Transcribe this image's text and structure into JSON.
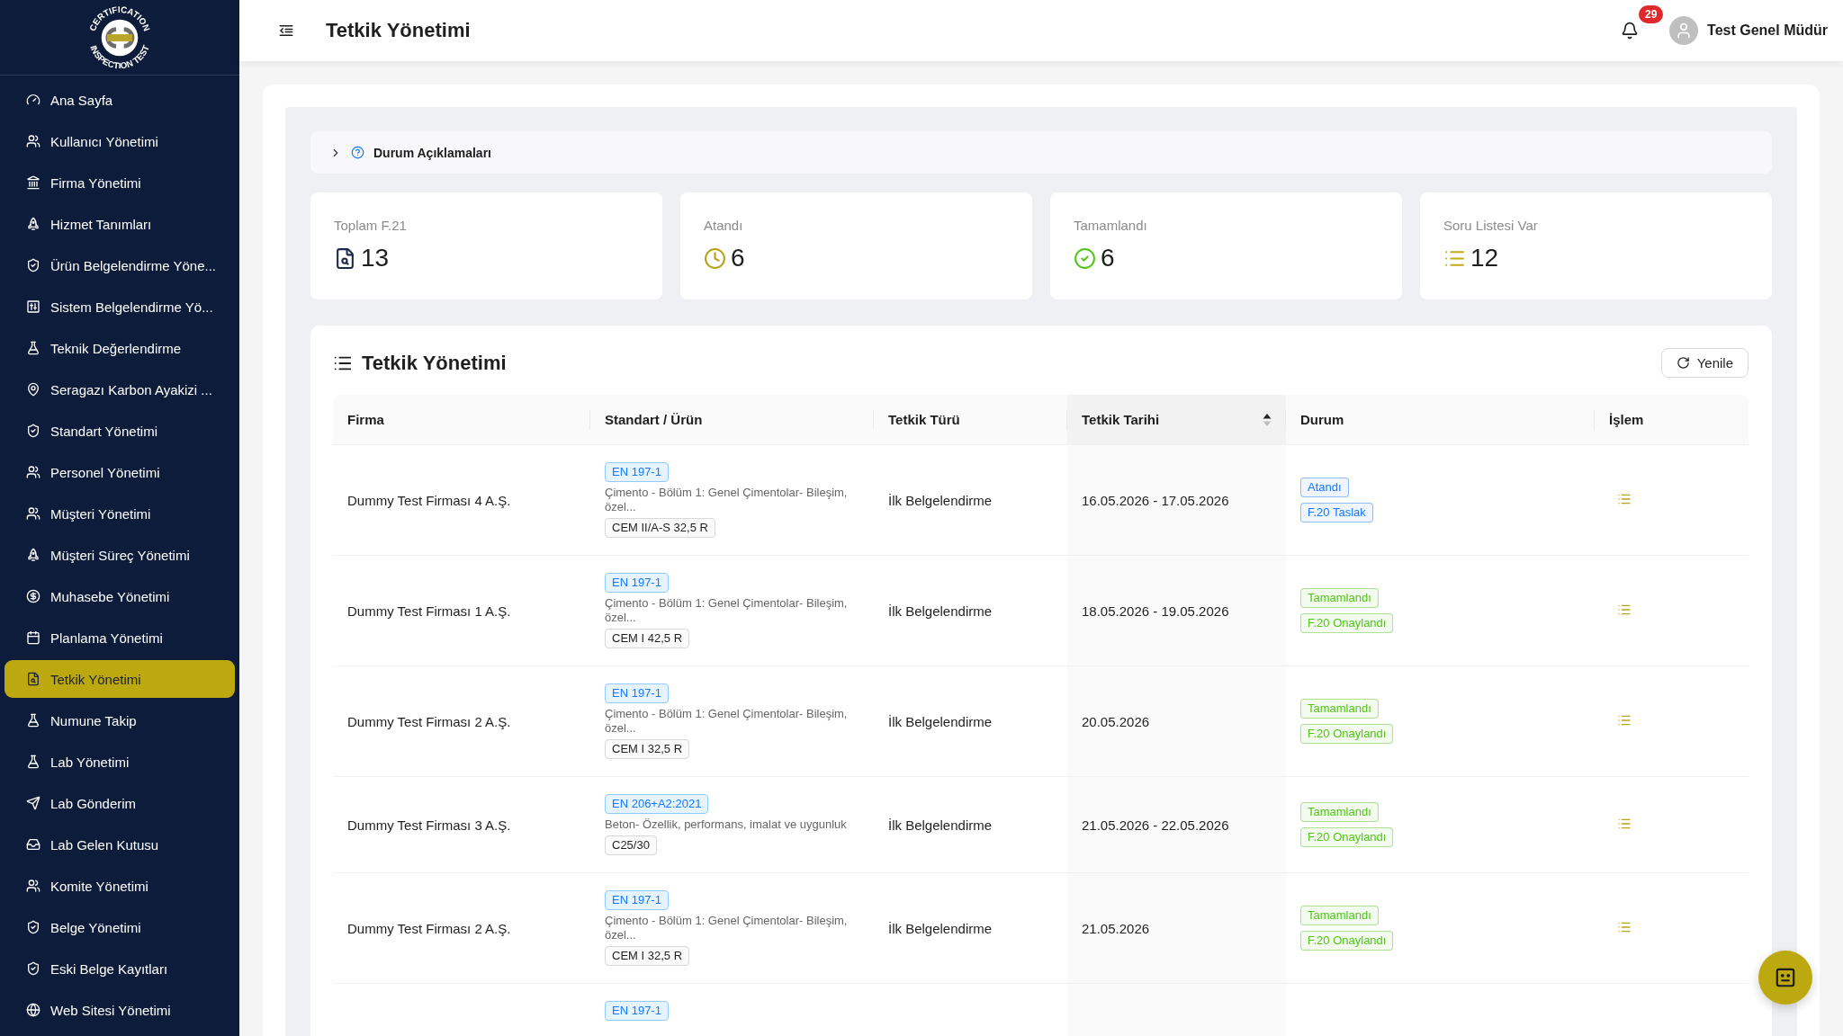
{
  "sidebar": {
    "logo": {
      "text_top": "CERTIFICATION",
      "text_bottom": "INSPECTION TEST"
    },
    "items": [
      {
        "label": "Ana Sayfa",
        "selected": false
      },
      {
        "label": "Kullanıcı Yönetimi",
        "selected": false
      },
      {
        "label": "Firma Yönetimi",
        "selected": false
      },
      {
        "label": "Hizmet Tanımları",
        "selected": false
      },
      {
        "label": "Ürün Belgelendirme Yöne...",
        "selected": false
      },
      {
        "label": "Sistem Belgelendirme Yö...",
        "selected": false
      },
      {
        "label": "Teknik Değerlendirme",
        "selected": false
      },
      {
        "label": "Seragazı Karbon Ayakizi ...",
        "selected": false
      },
      {
        "label": "Standart Yönetimi",
        "selected": false
      },
      {
        "label": "Personel Yönetimi",
        "selected": false
      },
      {
        "label": "Müşteri Yönetimi",
        "selected": false
      },
      {
        "label": "Müşteri Süreç Yönetimi",
        "selected": false
      },
      {
        "label": "Muhasebe Yönetimi",
        "selected": false
      },
      {
        "label": "Planlama Yönetimi",
        "selected": false
      },
      {
        "label": "Tetkik Yönetimi",
        "selected": true
      },
      {
        "label": "Numune Takip",
        "selected": false
      },
      {
        "label": "Lab Yönetimi",
        "selected": false
      },
      {
        "label": "Lab Gönderim",
        "selected": false
      },
      {
        "label": "Lab Gelen Kutusu",
        "selected": false
      },
      {
        "label": "Komite Yönetimi",
        "selected": false
      },
      {
        "label": "Belge Yönetimi",
        "selected": false
      },
      {
        "label": "Eski Belge Kayıtları",
        "selected": false
      },
      {
        "label": "Web Sitesi Yönetimi",
        "selected": false
      }
    ]
  },
  "header": {
    "title": "Tetkik Yönetimi",
    "notifications": "29",
    "user": "Test Genel Müdür"
  },
  "legend": {
    "title": "Durum Açıklamaları",
    "expanded": false
  },
  "stats": [
    {
      "label": "Toplam F.21",
      "value": "13"
    },
    {
      "label": "Atandı",
      "value": "6"
    },
    {
      "label": "Tamamlandı",
      "value": "6"
    },
    {
      "label": "Soru Listesi Var",
      "value": "12"
    }
  ],
  "table": {
    "title": "Tetkik Yönetimi",
    "refresh": "Yenile",
    "columns": [
      {
        "label": "Firma",
        "sorted": false
      },
      {
        "label": "Standart / Ürün",
        "sorted": false
      },
      {
        "label": "Tetkik Türü",
        "sorted": false
      },
      {
        "label": "Tetkik Tarihi",
        "sorted": true
      },
      {
        "label": "Durum",
        "sorted": false
      },
      {
        "label": "İşlem",
        "sorted": false
      }
    ],
    "rows": [
      {
        "firm": "Dummy Test Firması 4 A.Ş.",
        "standard": "EN 197-1",
        "description": "Çimento - Bölüm 1: Genel Çimentolar- Bileşim, özel...",
        "product": "CEM II/A-S 32,5 R",
        "type": "İlk Belgelendirme",
        "date": "16.05.2026 - 17.05.2026",
        "statuses": [
          {
            "label": "Atandı",
            "color": "#1677ff"
          },
          {
            "label": "F.20 Taslak",
            "color": "#1677ff"
          }
        ]
      },
      {
        "firm": "Dummy Test Firması 1 A.Ş.",
        "standard": "EN 197-1",
        "description": "Çimento - Bölüm 1: Genel Çimentolar- Bileşim, özel...",
        "product": "CEM I 42,5 R",
        "type": "İlk Belgelendirme",
        "date": "18.05.2026 - 19.05.2026",
        "statuses": [
          {
            "label": "Tamamlandı",
            "color": "#52c41a"
          },
          {
            "label": "F.20 Onaylandı",
            "color": "#52c41a"
          }
        ]
      },
      {
        "firm": "Dummy Test Firması 2 A.Ş.",
        "standard": "EN 197-1",
        "description": "Çimento - Bölüm 1: Genel Çimentolar- Bileşim, özel...",
        "product": "CEM I 32,5 R",
        "type": "İlk Belgelendirme",
        "date": "20.05.2026",
        "statuses": [
          {
            "label": "Tamamlandı",
            "color": "#52c41a"
          },
          {
            "label": "F.20 Onaylandı",
            "color": "#52c41a"
          }
        ]
      },
      {
        "firm": "Dummy Test Firması 3 A.Ş.",
        "standard": "EN 206+A2:2021",
        "description": "Beton- Özellik, performans, imalat ve uygunluk",
        "product": "C25/30",
        "type": "İlk Belgelendirme",
        "date": "21.05.2026 - 22.05.2026",
        "statuses": [
          {
            "label": "Tamamlandı",
            "color": "#52c41a"
          },
          {
            "label": "F.20 Onaylandı",
            "color": "#52c41a"
          }
        ]
      },
      {
        "firm": "Dummy Test Firması 2 A.Ş.",
        "standard": "EN 197-1",
        "description": "Çimento - Bölüm 1: Genel Çimentolar- Bileşim, özel...",
        "product": "CEM I 32,5 R",
        "type": "İlk Belgelendirme",
        "date": "21.05.2026",
        "statuses": [
          {
            "label": "Tamamlandı",
            "color": "#52c41a"
          },
          {
            "label": "F.20 Onaylandı",
            "color": "#52c41a"
          }
        ]
      },
      {
        "standard": "EN 197-1"
      }
    ]
  }
}
